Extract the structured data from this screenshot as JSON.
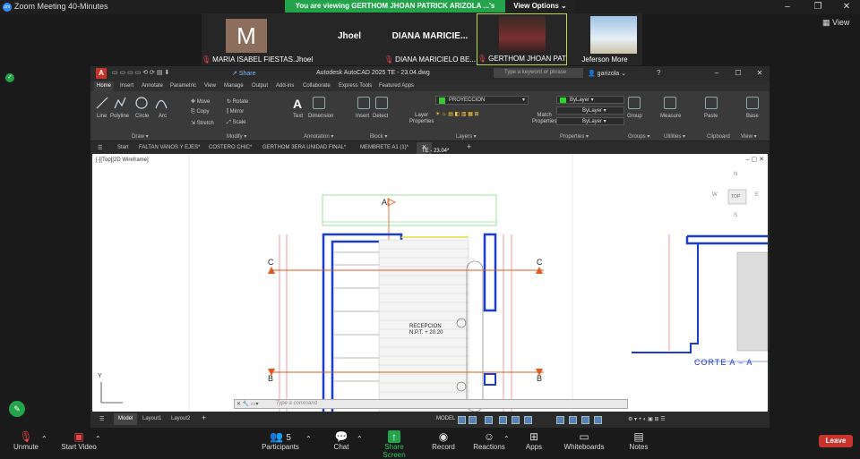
{
  "zoom": {
    "title": "Zoom Meeting 40-Minutes",
    "logo": "zm",
    "banner": "You are viewing GERTHOM JHOAN PATRICK ARIZOLA ...'s screen",
    "view_options": "View Options",
    "view_right": "View",
    "participants": [
      {
        "name": "MARIA ISABEL FIESTAS...",
        "letter": "M",
        "muted": true
      },
      {
        "name": "Jhoel",
        "big": "",
        "muted": false
      },
      {
        "name": "",
        "big": "Jhoel",
        "muted": false
      },
      {
        "name": "DIANA MARICIELO BE...",
        "big": "DIANA  MARICIE...",
        "muted": true
      },
      {
        "name": "GERTHOM JHOAN PATRIC...",
        "muted": true
      },
      {
        "name": "Jeferson More",
        "muted": false
      }
    ],
    "toolbar": {
      "unmute": "Unmute",
      "start_video": "Start Video",
      "participants": "Participants",
      "participants_count": "5",
      "chat": "Chat",
      "share": "Share Screen",
      "record": "Record",
      "reactions": "Reactions",
      "apps": "Apps",
      "whiteboards": "Whiteboards",
      "notes": "Notes",
      "leave": "Leave"
    }
  },
  "acad": {
    "logo": "A",
    "share": "Share",
    "app_title": "Autodesk AutoCAD 2025    TE - 23.04.dwg",
    "search_placeholder": "Type a keyword or phrase",
    "user": "garizola",
    "tabs": [
      "Home",
      "Insert",
      "Annotate",
      "Parametric",
      "View",
      "Manage",
      "Output",
      "Add-ins",
      "Collaborate",
      "Express Tools",
      "Featured Apps"
    ],
    "tools": {
      "line": "Line",
      "polyline": "Polyline",
      "circle": "Circle",
      "arc": "Arc",
      "move": "Move",
      "rotate": "Rotate",
      "copy": "Copy",
      "mirror": "Mirror",
      "stretch": "Stretch",
      "scale": "Scale",
      "text": "Text",
      "dimension": "Dimension",
      "insert": "Insert",
      "detect": "Detect",
      "layer_props": "Layer\nProperties",
      "layer_name": "PROYECCION",
      "match": "Match\nProperties",
      "bylayer": "ByLayer",
      "group": "Group",
      "measure": "Measure",
      "paste": "Paste",
      "base": "Base"
    },
    "panels": [
      "Draw",
      "Modify",
      "Annotation",
      "Block",
      "Layers",
      "Properties",
      "Groups",
      "Utilities",
      "Clipboard",
      "View"
    ],
    "doc_tabs": [
      "Start",
      "FALTAN VANOS Y EJES*",
      "COSTERO CHIC*",
      "GERTHOM 3ERA UNIDAD FINAL*",
      "MEMBRETE A1 (1)*",
      "TE - 23.04*"
    ],
    "viewport_label": "[-][Top][2D Wireframe]",
    "cmd_placeholder": "Type a command",
    "layouts": [
      "Model",
      "Layout1",
      "Layout2"
    ],
    "status_model": "MODEL",
    "drawing": {
      "label_a": "A",
      "label_c": "C",
      "label_b": "B",
      "reception": "RECEPCION",
      "npt": "N.P.T. + 20.20",
      "corte": "CORTE  A  –  A",
      "compass_n": "N",
      "compass_s": "S",
      "compass_e": "E",
      "compass_w": "W",
      "compass_top": "TOP",
      "axis_y": "Y"
    }
  }
}
